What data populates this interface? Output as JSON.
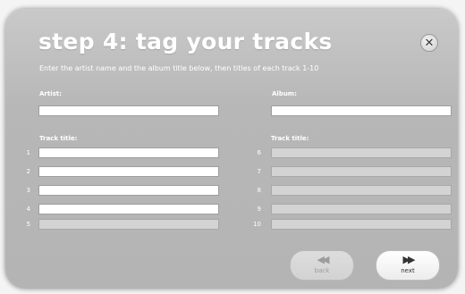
{
  "dialog": {
    "title": "step 4: tag your tracks",
    "instructions": "Enter the artist name and the album title below, then titles of each track 1-10",
    "close_symbol": "✕"
  },
  "artist": {
    "label": "Artist:",
    "value": ""
  },
  "album": {
    "label": "Album:",
    "value": ""
  },
  "tracks_left": {
    "label": "Track title:",
    "items": [
      {
        "number": "1",
        "value": "",
        "enabled": true
      },
      {
        "number": "2",
        "value": "",
        "enabled": true
      },
      {
        "number": "3",
        "value": "",
        "enabled": true
      },
      {
        "number": "4",
        "value": "",
        "enabled": true
      },
      {
        "number": "5",
        "value": "",
        "enabled": false
      }
    ]
  },
  "tracks_right": {
    "label": "Track title:",
    "items": [
      {
        "number": "6",
        "value": "",
        "enabled": false
      },
      {
        "number": "7",
        "value": "",
        "enabled": false
      },
      {
        "number": "8",
        "value": "",
        "enabled": false
      },
      {
        "number": "9",
        "value": "",
        "enabled": false
      },
      {
        "number": "10",
        "value": "",
        "enabled": false
      }
    ]
  },
  "buttons": {
    "back": {
      "label": "back",
      "icon": "rewind-icon",
      "glyph": "◀◀",
      "enabled": false
    },
    "next": {
      "label": "next",
      "icon": "fast-forward-icon",
      "glyph": "▶▶",
      "enabled": true
    }
  }
}
